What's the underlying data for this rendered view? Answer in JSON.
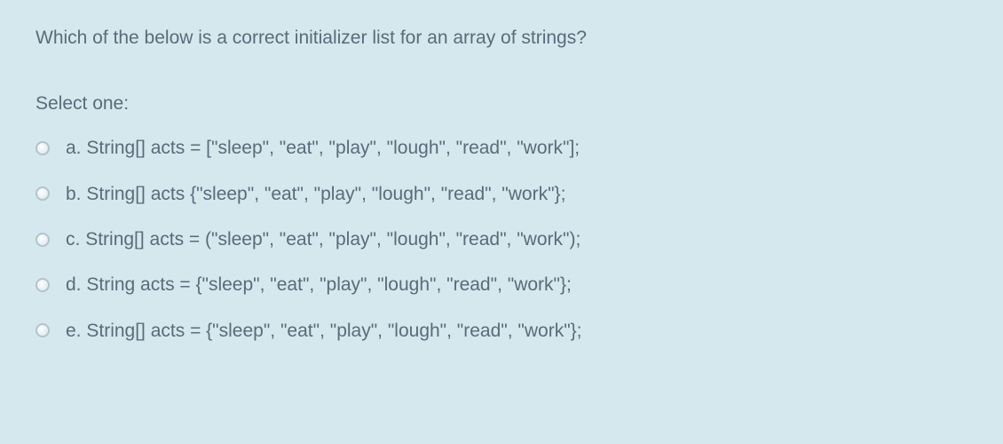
{
  "question": "Which of the below is a correct initializer list for an array of strings?",
  "prompt": "Select one:",
  "options": [
    {
      "letter": "a.",
      "text": "String[] acts = [\"sleep\", \"eat\", \"play\", \"lough\", \"read\", \"work\"];"
    },
    {
      "letter": "b.",
      "text": "String[] acts {\"sleep\", \"eat\", \"play\", \"lough\", \"read\", \"work\"};"
    },
    {
      "letter": "c.",
      "text": "String[] acts = (\"sleep\", \"eat\", \"play\", \"lough\", \"read\", \"work\");"
    },
    {
      "letter": "d.",
      "text": "String acts = {\"sleep\", \"eat\", \"play\", \"lough\", \"read\", \"work\"};"
    },
    {
      "letter": "e.",
      "text": "String[] acts = {\"sleep\", \"eat\", \"play\", \"lough\", \"read\", \"work\"};"
    }
  ]
}
